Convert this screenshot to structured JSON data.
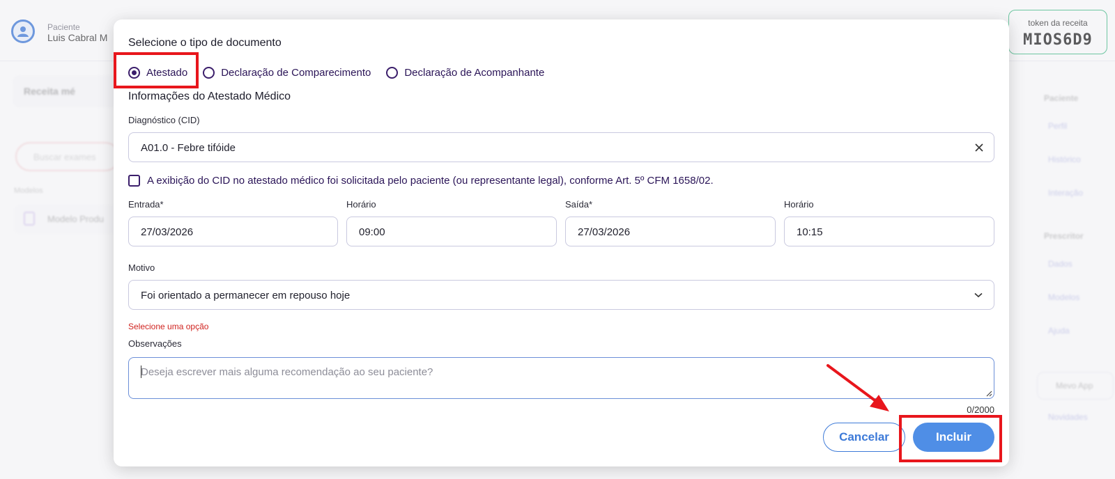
{
  "background": {
    "patient_caption": "Paciente",
    "patient_name": "Luis Cabral M",
    "token": {
      "caption": "token da receita",
      "value": "MIOS6D9"
    },
    "left_card": "Receita mé",
    "search_placeholder": "Buscar exames",
    "models_label": "Modelos",
    "model_item": "Modelo Produ",
    "side": {
      "patient_header": "Paciente",
      "items_patient": [
        "Perfil",
        "Histórico",
        "Interação"
      ],
      "prescriber_header": "Prescritor",
      "items_prescriber": [
        "Dados",
        "Modelos",
        "Ajuda"
      ],
      "app_button": "Mevo App",
      "news": "Novidades"
    }
  },
  "modal": {
    "title": "Selecione o tipo de documento",
    "document_types": [
      {
        "label": "Atestado",
        "checked": true
      },
      {
        "label": "Declaração de Comparecimento",
        "checked": false
      },
      {
        "label": "Declaração de Acompanhante",
        "checked": false
      }
    ],
    "section_title": "Informações do Atestado Médico",
    "diagnosis": {
      "label": "Diagnóstico (CID)",
      "value": "A01.0 - Febre tifóide"
    },
    "cid_consent": {
      "label": "A exibição do CID no atestado médico foi solicitada pelo paciente (ou representante legal), conforme Art. 5º CFM 1658/02.",
      "checked": false
    },
    "entry": {
      "label": "Entrada*",
      "value": "27/03/2026"
    },
    "entry_time": {
      "label": "Horário",
      "value": "09:00"
    },
    "exit": {
      "label": "Saída*",
      "value": "27/03/2026"
    },
    "exit_time": {
      "label": "Horário",
      "value": "10:15"
    },
    "reason": {
      "label": "Motivo",
      "value": "Foi orientado a permanecer em repouso hoje",
      "error": "Selecione uma opção"
    },
    "notes": {
      "label": "Observações",
      "placeholder": "Deseja escrever mais alguma recomendação ao seu paciente?",
      "counter": "0/2000"
    },
    "buttons": {
      "cancel": "Cancelar",
      "include": "Incluir"
    }
  },
  "colors": {
    "primary_blue": "#4f8ee6",
    "radio_purple": "#3b1e6b",
    "error_red": "#d0231f",
    "annotation_red": "#e8161c",
    "token_border": "#2fb67a"
  }
}
